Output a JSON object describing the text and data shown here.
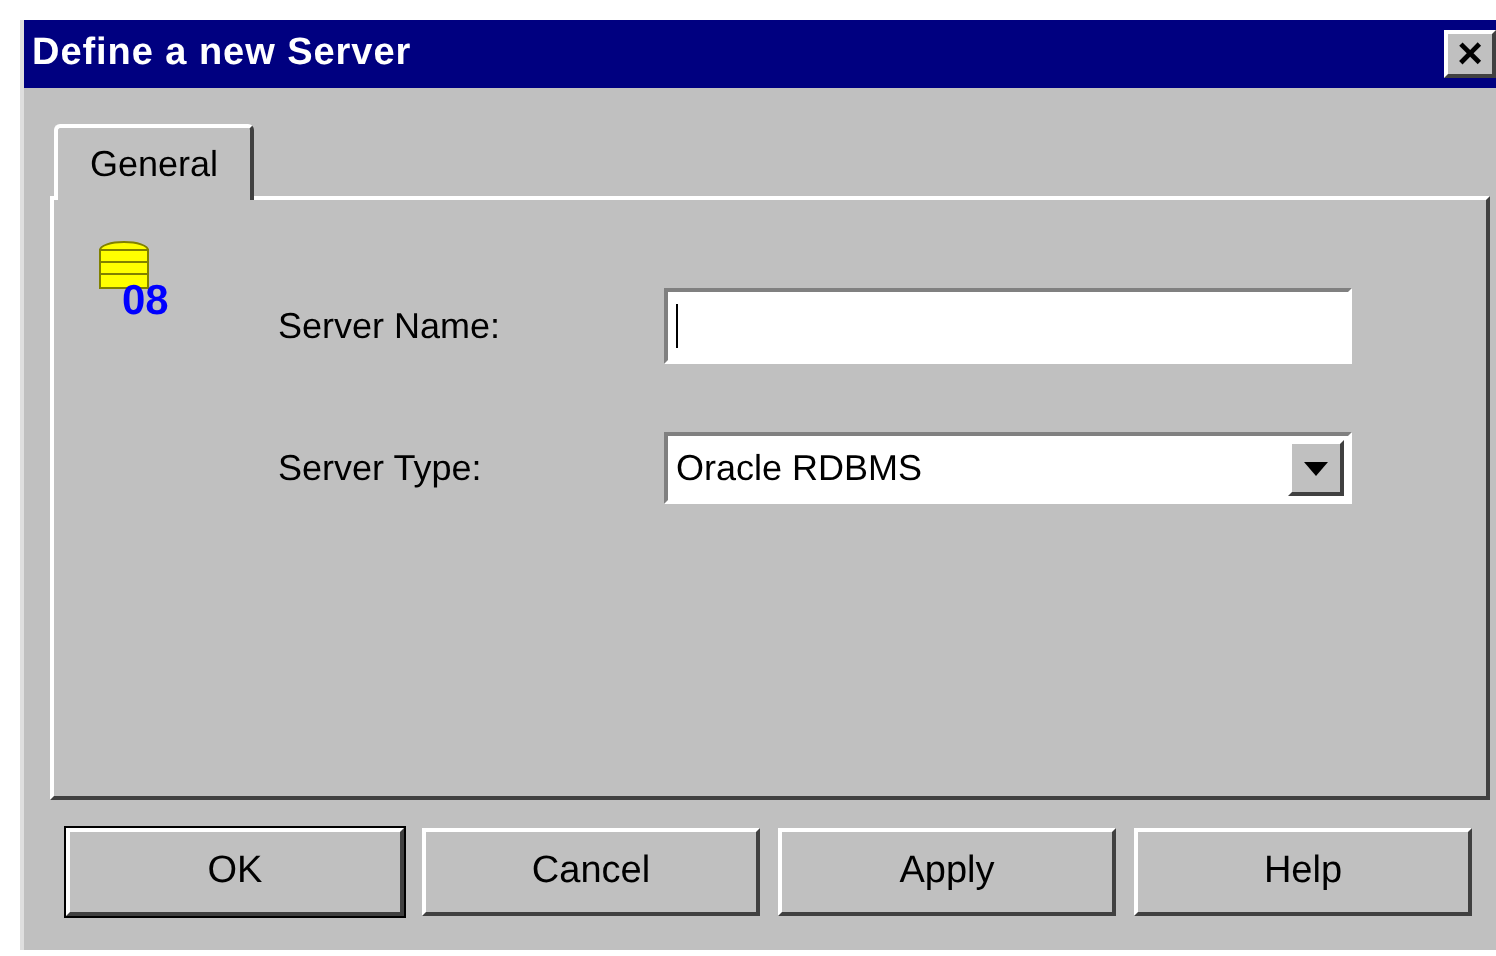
{
  "window": {
    "title": "Define a new Server",
    "close": "×"
  },
  "tabs": [
    {
      "label": "General",
      "selected": true
    }
  ],
  "fields": [
    {
      "kind": "text",
      "label": "Server Name:",
      "focused": true
    },
    {
      "kind": "dropdown",
      "label": "Server Type:",
      "value": "Oracle RDBMS"
    }
  ],
  "icon_badge": "08",
  "buttons": [
    {
      "label": "OK",
      "default": true
    },
    {
      "label": "Cancel",
      "default": false
    },
    {
      "label": "Apply",
      "default": false
    },
    {
      "label": "Help",
      "default": false
    }
  ]
}
